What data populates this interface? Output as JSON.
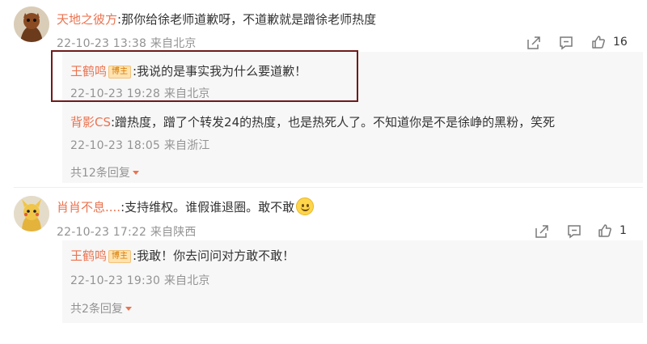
{
  "comment1": {
    "username": "天地之彼方",
    "text": ":那你给徐老师道歉呀，不道歉就是蹭徐老师热度",
    "time": "22-10-23 13:38",
    "location": "来自北京",
    "like_count": "16",
    "replies": [
      {
        "username": "王鹤鸣",
        "badge": "博主",
        "text": ":我说的是事实我为什么要道歉！",
        "time": "22-10-23 19:28",
        "location": "来自北京"
      },
      {
        "username": "背影CS",
        "text": ":蹭热度，蹭了个转发24的热度，也是热死人了。不知道你是不是徐峥的黑粉，笑死",
        "time": "22-10-23 18:05",
        "location": "来自浙江"
      }
    ],
    "more_replies": "共12条回复"
  },
  "comment2": {
    "username": "肖肖不息....",
    "text": ":支持维权。谁假谁退圈。敢不敢",
    "time": "22-10-23 17:22",
    "location": "来自陕西",
    "like_count": "1",
    "replies": [
      {
        "username": "王鹤鸣",
        "badge": "博主",
        "text": ":我敢！你去问问对方敢不敢！",
        "time": "22-10-23 19:30",
        "location": "来自北京"
      }
    ],
    "more_replies": "共2条回复"
  },
  "icons": {
    "share": "share-icon",
    "comment": "comment-icon",
    "like": "like-icon",
    "emoji": "smile-emoji-icon",
    "expand": "chevron-down-icon"
  },
  "colors": {
    "username": "#eb7350",
    "meta": "#939393",
    "reply_background": "#f7f7f7",
    "highlight_border": "#6f1a1a"
  }
}
